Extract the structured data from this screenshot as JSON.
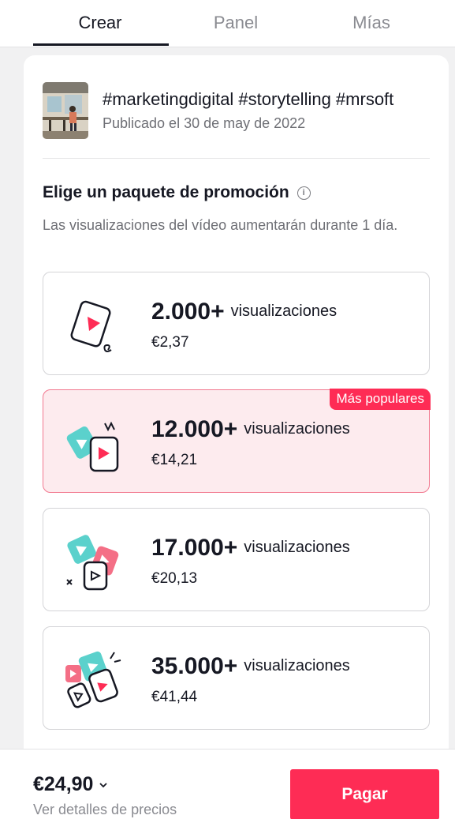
{
  "tabs": [
    {
      "label": "Crear",
      "active": true
    },
    {
      "label": "Panel",
      "active": false
    },
    {
      "label": "Mías",
      "active": false
    }
  ],
  "video": {
    "title": "#marketingdigital #storytelling #mrsoft",
    "date": "Publicado el 30 de may de 2022"
  },
  "promo": {
    "title": "Elige un paquete de promoción",
    "description": "Las visualizaciones del vídeo aumentarán durante 1 día."
  },
  "packages": [
    {
      "count": "2.000+",
      "unit": "visualizaciones",
      "price": "€2,37",
      "selected": false
    },
    {
      "count": "12.000+",
      "unit": "visualizaciones",
      "price": "€14,21",
      "selected": true,
      "badge": "Más populares"
    },
    {
      "count": "17.000+",
      "unit": "visualizaciones",
      "price": "€20,13",
      "selected": false
    },
    {
      "count": "35.000+",
      "unit": "visualizaciones",
      "price": "€41,44",
      "selected": false
    }
  ],
  "footer": {
    "total": "€24,90",
    "details": "Ver detalles de precios",
    "pay_label": "Pagar"
  },
  "colors": {
    "accent": "#fe2c55",
    "teal": "#5bd1cc",
    "selected_bg": "#fdebee"
  },
  "icons": [
    "info-icon",
    "chevron-down-icon",
    "video-card-icon"
  ]
}
